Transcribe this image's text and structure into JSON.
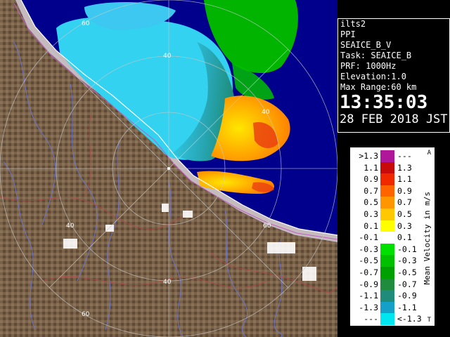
{
  "info": {
    "lines": [
      "ilts2",
      "PPI",
      "SEAICE_B_V",
      "Task: SEAICE_B",
      "PRF: 1000Hz",
      "Elevation:1.0",
      "Max Range:60 km"
    ],
    "time": "13:35:03",
    "date": "28 FEB 2018 JST"
  },
  "range_labels": [
    "60",
    "40",
    "40",
    "40",
    "40",
    "60",
    "60"
  ],
  "legend": {
    "title": "Mean Velocity in m/s",
    "top_mark": "A",
    "bottom_mark": "T",
    "rows": [
      {
        "lo": ">1.3",
        "hi": "---",
        "color": "#b0169a"
      },
      {
        "lo": "1.1",
        "hi": "1.3",
        "color": "#c80a0a"
      },
      {
        "lo": "0.9",
        "hi": "1.1",
        "color": "#f02800"
      },
      {
        "lo": "0.7",
        "hi": "0.9",
        "color": "#ff6400"
      },
      {
        "lo": "0.5",
        "hi": "0.7",
        "color": "#ff9600"
      },
      {
        "lo": "0.3",
        "hi": "0.5",
        "color": "#ffc800"
      },
      {
        "lo": "0.1",
        "hi": "0.3",
        "color": "#ffff00"
      },
      {
        "lo": "-0.1",
        "hi": "0.1",
        "color": "#ffffff"
      },
      {
        "lo": "-0.3",
        "hi": "-0.1",
        "color": "#00e000"
      },
      {
        "lo": "-0.5",
        "hi": "-0.3",
        "color": "#00c000"
      },
      {
        "lo": "-0.7",
        "hi": "-0.5",
        "color": "#00a000"
      },
      {
        "lo": "-0.9",
        "hi": "-0.7",
        "color": "#1e8c3c"
      },
      {
        "lo": "-1.1",
        "hi": "-0.9",
        "color": "#1e8c78"
      },
      {
        "lo": "-1.3",
        "hi": "-1.1",
        "color": "#14a0c8"
      },
      {
        "lo": "---",
        "hi": "<-1.3",
        "color": "#00e6f0"
      }
    ]
  },
  "colors": {
    "sea": "#00008c",
    "land": "#7a6248",
    "echo_cyan": "#32d2f0",
    "echo_teal": "#28b4c8",
    "echo_green": "#00c000",
    "echo_yellow": "#ffc800",
    "echo_orange": "#ff9600",
    "echo_red": "#e83a10",
    "ring": "#c8c8c8"
  }
}
